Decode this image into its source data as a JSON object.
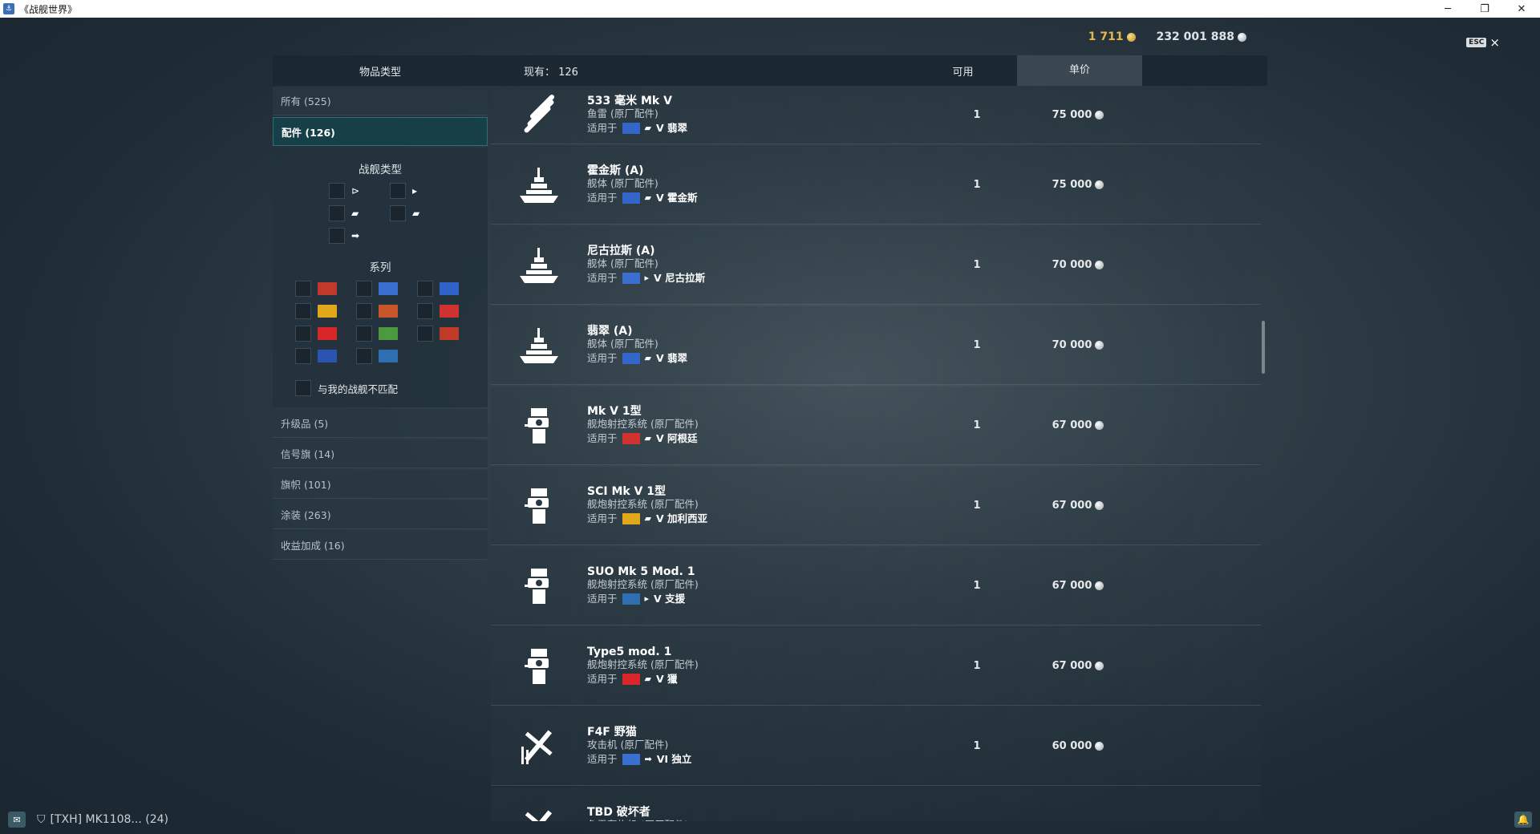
{
  "window": {
    "title": "《战舰世界》",
    "minimize": "─",
    "restore": "❐",
    "close": "✕"
  },
  "currency": {
    "gold": "1 711",
    "credits": "232 001 888"
  },
  "esc": {
    "key": "ESC",
    "close": "×"
  },
  "header": {
    "item_type": "物品类型",
    "count": "现有： 126",
    "available": "可用",
    "unit_price": "单价"
  },
  "sidebar": {
    "all": "所有 (525)",
    "modules": "配件 (126)",
    "ship_type_title": "战舰类型",
    "ship_types": [
      "⊳",
      "▸",
      "▰",
      "▰",
      "➡"
    ],
    "nation_title": "系列",
    "mismatch_label": "与我的战舰不匹配",
    "others": [
      "升级品 (5)",
      "信号旗 (14)",
      "旗帜 (101)",
      "涂装 (263)",
      "收益加成 (16)"
    ]
  },
  "nations": [
    {
      "color": "#c0392b"
    },
    {
      "color": "#3b6fcf"
    },
    {
      "color": "#2f63c9"
    },
    {
      "color": "#e2a81c"
    },
    {
      "color": "#c9562a"
    },
    {
      "color": "#d0332f"
    },
    {
      "color": "#d8262b"
    },
    {
      "color": "#4c9a3e"
    },
    {
      "color": "#c0392b"
    },
    {
      "color": "#2a54b0"
    },
    {
      "color": "#2d6fb0"
    }
  ],
  "items": [
    {
      "name": "533 毫米 Mk V",
      "sub": "鱼雷 (原厂配件)",
      "applies": "适用于",
      "flag": "#3465c9",
      "glyph": "▰",
      "ship": "V 翡翠",
      "available": "1",
      "price": "75 000",
      "icon": "torpedo"
    },
    {
      "name": "霍金斯 (A)",
      "sub": "舰体 (原厂配件)",
      "applies": "适用于",
      "flag": "#3465c9",
      "glyph": "▰",
      "ship": "V 霍金斯",
      "available": "1",
      "price": "75 000",
      "icon": "hull"
    },
    {
      "name": "尼古拉斯 (A)",
      "sub": "舰体 (原厂配件)",
      "applies": "适用于",
      "flag": "#3b6fcf",
      "glyph": "▸",
      "ship": "V 尼古拉斯",
      "available": "1",
      "price": "70 000",
      "icon": "hull"
    },
    {
      "name": "翡翠 (A)",
      "sub": "舰体 (原厂配件)",
      "applies": "适用于",
      "flag": "#3465c9",
      "glyph": "▰",
      "ship": "V 翡翠",
      "available": "1",
      "price": "70 000",
      "icon": "hull"
    },
    {
      "name": "Mk V 1型",
      "sub": "舰炮射控系统 (原厂配件)",
      "applies": "适用于",
      "flag": "#d0332f",
      "glyph": "▰",
      "ship": "V 阿根廷",
      "available": "1",
      "price": "67 000",
      "icon": "fire-control"
    },
    {
      "name": "SCI Mk V 1型",
      "sub": "舰炮射控系统 (原厂配件)",
      "applies": "适用于",
      "flag": "#e2a81c",
      "glyph": "▰",
      "ship": "V 加利西亚",
      "available": "1",
      "price": "67 000",
      "icon": "fire-control"
    },
    {
      "name": "SUO Mk 5 Mod. 1",
      "sub": "舰炮射控系统 (原厂配件)",
      "applies": "适用于",
      "flag": "#2d6fb0",
      "glyph": "▸",
      "ship": "V 支援",
      "available": "1",
      "price": "67 000",
      "icon": "fire-control"
    },
    {
      "name": "Type5 mod. 1",
      "sub": "舰炮射控系统 (原厂配件)",
      "applies": "适用于",
      "flag": "#d8262b",
      "glyph": "▰",
      "ship": "V 獵",
      "available": "1",
      "price": "67 000",
      "icon": "fire-control"
    },
    {
      "name": "F4F 野猫",
      "sub": "攻击机 (原厂配件)",
      "applies": "适用于",
      "flag": "#3b6fcf",
      "glyph": "➡",
      "ship": "VI 独立",
      "available": "1",
      "price": "60 000",
      "icon": "aircraft"
    },
    {
      "name": "TBD 破坏者",
      "sub": "鱼雷轰炸机 (原厂配件)",
      "applies": "适用于",
      "flag": "#3b6fcf",
      "glyph": "➡",
      "ship": "",
      "available": "",
      "price": "",
      "icon": "aircraft"
    }
  ],
  "footer": {
    "clan": "[TXH]  MK1108...  (24)"
  }
}
